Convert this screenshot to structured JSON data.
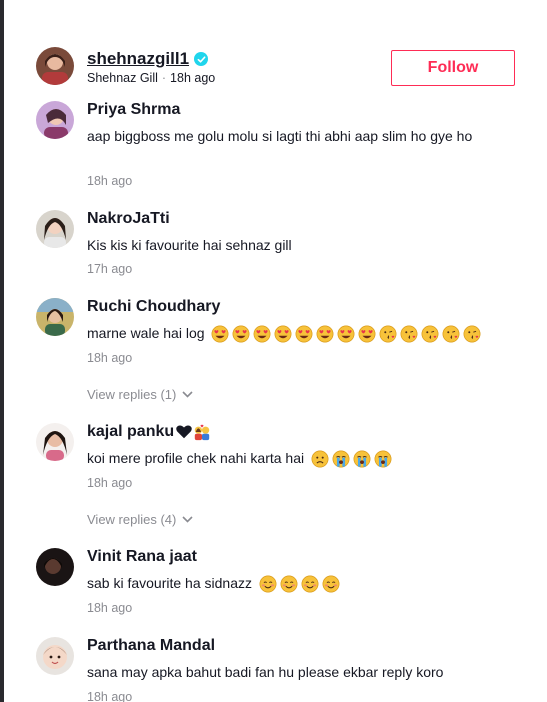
{
  "header": {
    "username": "shehnazgill1",
    "display_name": "Shehnaz Gill",
    "separator": "·",
    "time": "18h ago",
    "follow_label": "Follow"
  },
  "comments": [
    {
      "name": "Priya Shrma",
      "text": "aap biggboss me golu molu si lagti thi abhi aap slim ho gye ho",
      "time": "18h ago"
    },
    {
      "name": "NakroJaTti",
      "text": "Kis kis ki favourite hai sehnaz gill",
      "time": "17h ago"
    },
    {
      "name": "Ruchi Choudhary",
      "text": "marne wale hai log",
      "time": "18h ago",
      "replies": "View replies (1)"
    },
    {
      "name": "kajal panku",
      "text": "koi mere profile chek nahi karta hai",
      "time": "18h ago",
      "replies": "View replies (4)"
    },
    {
      "name": "Vinit Rana jaat",
      "text": "sab ki favourite ha sidnazz",
      "time": "18h ago"
    },
    {
      "name": "Parthana Mandal",
      "text": "sana may apka bahut badi fan hu please ekbar reply koro",
      "time": "18h ago"
    }
  ],
  "colors": {
    "accent": "#fe2c55",
    "verified": "#20d5ec",
    "muted": "#8a8b91"
  },
  "icons": {
    "verified": "verified-badge-icon",
    "chevron": "chevron-down-icon"
  }
}
